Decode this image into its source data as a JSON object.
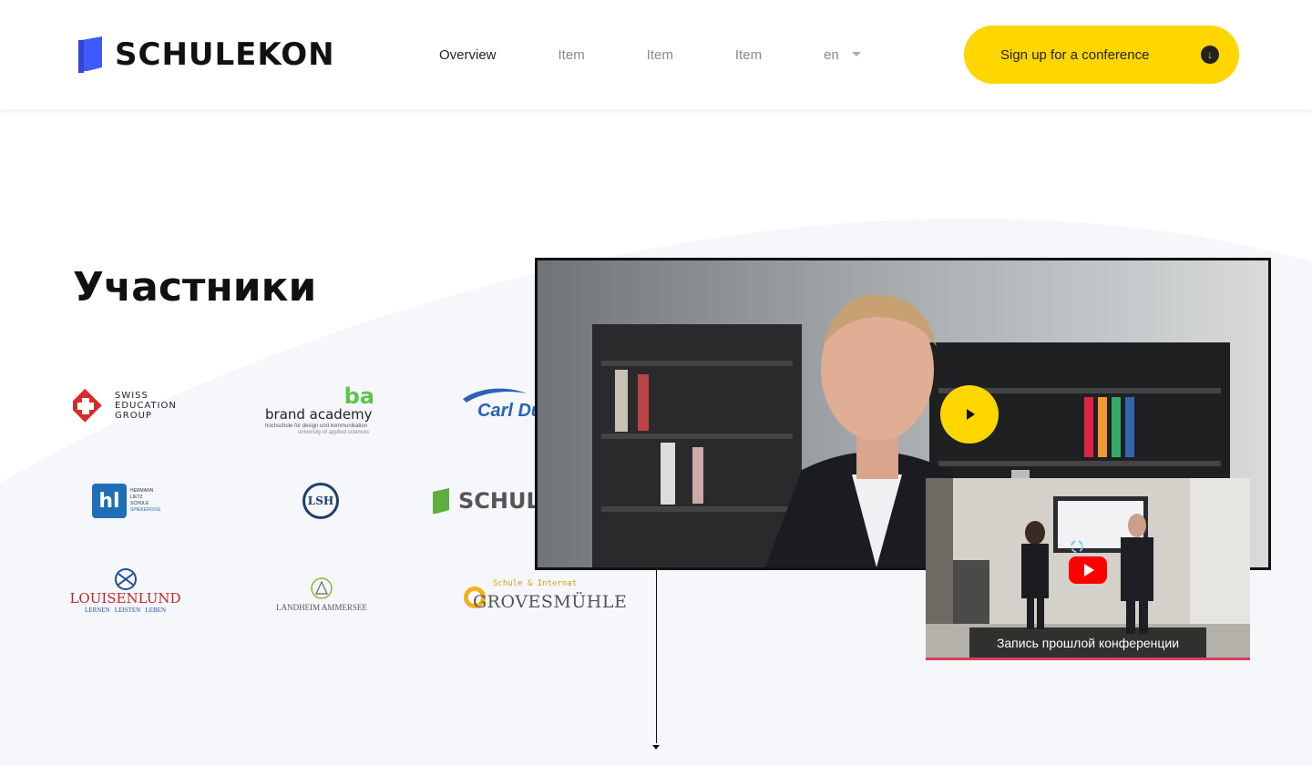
{
  "header": {
    "logo_text": "SCHULEKON",
    "nav": [
      {
        "label": "Overview",
        "active": true
      },
      {
        "label": "Item",
        "active": false
      },
      {
        "label": "Item",
        "active": false
      },
      {
        "label": "Item",
        "active": false
      }
    ],
    "language": "en",
    "cta_label": "Sign up for a conference",
    "cta_icon": "download-arrow-icon"
  },
  "section": {
    "title": "Участники"
  },
  "partners": [
    {
      "name": "swiss-education-group-logo",
      "lines": [
        "SWISS",
        "EDUCATION",
        "GROUP"
      ]
    },
    {
      "name": "brand-academy-logo",
      "text": "brand academy",
      "sub": "hochschule für design und kommunikation",
      "sub2": "university of applied sciences",
      "badge": "ba"
    },
    {
      "name": "carl-duisberg-logo",
      "text": "Carl Du"
    },
    {
      "name": "hermann-lietz-logo",
      "badge": "hl",
      "lines": [
        "HERMANN",
        "LIETZ",
        "SCHULE",
        "SPIEKEROOG"
      ]
    },
    {
      "name": "lsh-logo",
      "text": "LSH"
    },
    {
      "name": "schulekon-partner-logo",
      "text": "SCHUL"
    },
    {
      "name": "louisenlund-logo",
      "text": "LOUISENLUND",
      "sub": "LERNEN   LEISTEN   LEBEN"
    },
    {
      "name": "landheim-ammersee-logo",
      "text": "LANDHEIM AMMERSEE"
    },
    {
      "name": "grovesmuehle-logo",
      "sub": "Schule & Internat",
      "text": "GROVESMÜHLE"
    }
  ],
  "video": {
    "play_icon": "play-icon",
    "thumbnail_caption": "Запись прошлой конференции",
    "thumbnail_icon": "youtube-play-icon"
  },
  "colors": {
    "accent_yellow": "#ffd600",
    "nav_active": "#3d5afe",
    "brand_blue": "#3d5afe",
    "background_curve": "#f6f7fa"
  }
}
